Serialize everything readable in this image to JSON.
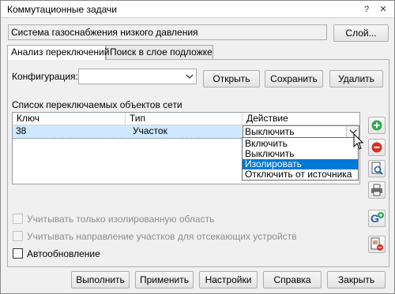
{
  "window": {
    "title": "Коммутационные задачи",
    "help_glyph": "?",
    "close_glyph": "✕"
  },
  "layer": {
    "value": "Система газоснабжения низкого давления",
    "button_label": "Слой..."
  },
  "tabs": [
    {
      "label": "Анализ переключений",
      "active": true
    },
    {
      "label": "Поиск в слое подложке",
      "active": false
    }
  ],
  "config": {
    "label": "Конфигурация:",
    "value": "",
    "open_label": "Открыть",
    "save_label": "Сохранить",
    "delete_label": "Удалить"
  },
  "grid": {
    "title": "Список переключаемых объектов сети",
    "columns": [
      "Ключ",
      "Тип",
      "Действие"
    ],
    "rows": [
      {
        "key": "38",
        "type": "Участок",
        "action": "Выключить"
      }
    ]
  },
  "action_dropdown": {
    "options": [
      "Включить",
      "Выключить",
      "Изолировать",
      "Отключить от источника"
    ],
    "highlighted": "Изолировать"
  },
  "side_icons": [
    "add-icon",
    "remove-icon",
    "zoom-to-object-icon",
    "print-icon",
    "add-from-map-icon",
    "clear-list-icon"
  ],
  "options": {
    "isolated_only": {
      "label": "Учитывать только изолированную область",
      "checked": false,
      "enabled": false
    },
    "direction": {
      "label": "Учитывать направление участков для отсекающих устройств",
      "checked": false,
      "enabled": false
    },
    "autoupdate": {
      "label": "Автообновление",
      "checked": false,
      "enabled": true
    }
  },
  "footer": {
    "run_label": "Выполнить",
    "apply_label": "Применить",
    "settings_label": "Настройки",
    "help_label": "Справка",
    "close_label": "Закрыть"
  },
  "colors": {
    "selection": "#0078d7",
    "row_highlight": "#cde8ff",
    "add_green": "#2fa84f",
    "remove_red": "#d93025"
  }
}
